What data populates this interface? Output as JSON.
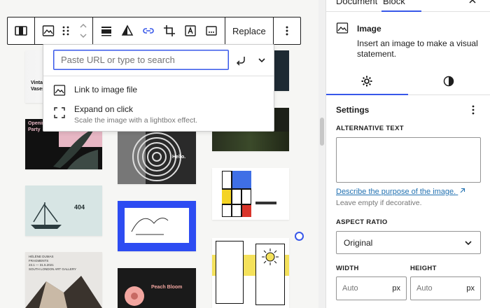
{
  "toolbar": {
    "groups": [
      {
        "icon": "align-icon"
      },
      {
        "icons": [
          "image-icon",
          "drag-icon",
          "chevron-up-icon",
          "chevron-down-icon"
        ]
      },
      {
        "icons": [
          "align-bottom-icon",
          "duotone-icon",
          "link-icon",
          "crop-icon",
          "text-overlay-icon",
          "more-options-icon"
        ]
      },
      {
        "replace_label": "Replace"
      },
      {
        "icon": "more-vertical-icon"
      }
    ]
  },
  "link_popover": {
    "url_placeholder": "Paste URL or type to search",
    "url_value": "",
    "items": [
      {
        "title": "Link to image file",
        "description": ""
      },
      {
        "title": "Expand on click",
        "description": "Scale the image with a lightbox effect."
      }
    ]
  },
  "canvas": {
    "thumbnails": [
      {
        "label": "Vintag Vases",
        "bg": "#ffffff"
      },
      {
        "label": "Openin Party",
        "bg": "#111111"
      },
      {
        "label": "404",
        "bg": "#d7e5e4"
      },
      {
        "label": "HÉLÈNE DUMAS FRAGMENTS 23.1 — 31.5.2021 SOUTH LONDON ART GALLERY",
        "bg": "#e8e6e3"
      },
      {
        "label": "Hello.",
        "bg": "#2a2a2a"
      },
      {
        "label": "Peach Bloom",
        "bg": "#1a1a1a"
      }
    ]
  },
  "sidebar": {
    "tabs": [
      "Document",
      "Block"
    ],
    "active_tab": "Block",
    "close_icon": "close-icon",
    "block_card": {
      "title": "Image",
      "description": "Insert an image to make a visual statement."
    },
    "sub_tabs": [
      "settings-icon",
      "styles-icon"
    ],
    "settings": {
      "heading": "Settings",
      "alt_text_label": "Alternative text",
      "alt_text_value": "",
      "alt_link": "Describe the purpose of the image.",
      "alt_help": "Leave empty if decorative.",
      "aspect_ratio_label": "Aspect ratio",
      "aspect_ratio_value": "Original",
      "width_label": "Width",
      "height_label": "Height",
      "width_placeholder": "Auto",
      "height_placeholder": "Auto",
      "unit": "px"
    }
  },
  "colors": {
    "accent": "#3858e9",
    "link": "#2271b1",
    "border": "#1e1e1e"
  }
}
